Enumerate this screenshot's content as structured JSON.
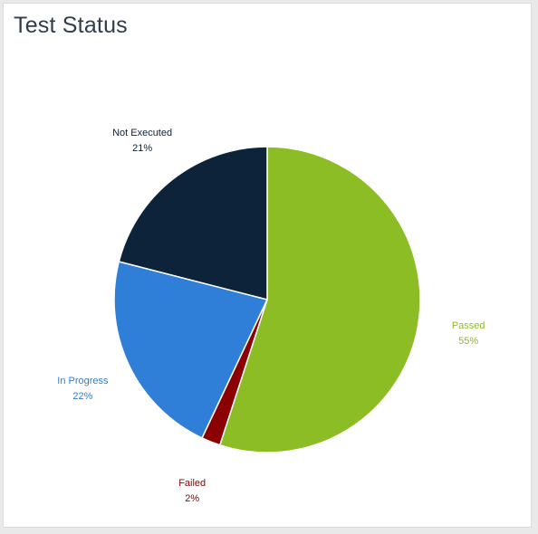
{
  "panel": {
    "title": "Test Status"
  },
  "chart_data": {
    "type": "pie",
    "start_angle_deg": 0,
    "direction": "clockwise",
    "slice_border_color": "#ffffff",
    "slices": [
      {
        "name": "Passed",
        "value": 55,
        "percent_label": "55%",
        "color": "#8cbd24",
        "label_position": "right"
      },
      {
        "name": "Failed",
        "value": 2,
        "percent_label": "2%",
        "color": "#8b0000",
        "label_position": "bottom"
      },
      {
        "name": "In Progress",
        "value": 22,
        "percent_label": "22%",
        "color": "#2f7ed8",
        "label_position": "left"
      },
      {
        "name": "Not Executed",
        "value": 21,
        "percent_label": "21%",
        "color": "#0d233a",
        "label_position": "top-left"
      }
    ]
  }
}
